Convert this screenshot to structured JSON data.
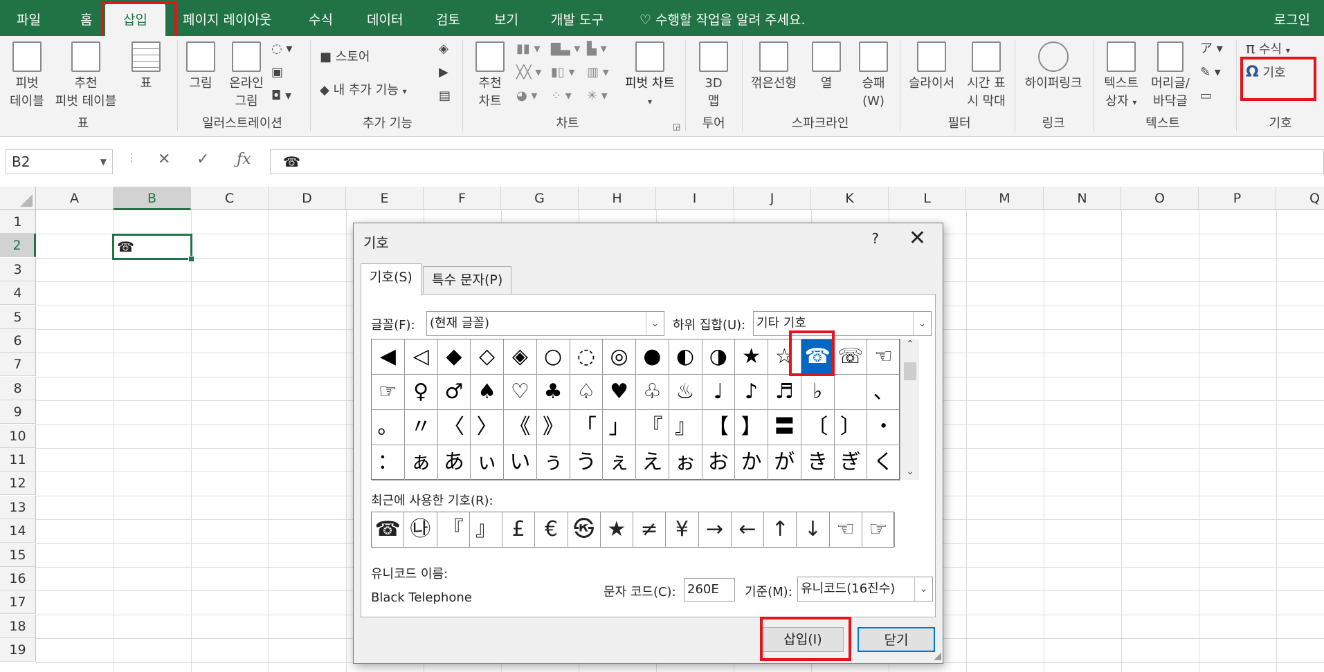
{
  "menu": {
    "tabs": [
      "파일",
      "홈",
      "삽입",
      "페이지 레이아웃",
      "수식",
      "데이터",
      "검토",
      "보기",
      "개발 도구"
    ],
    "active_tab": "삽입",
    "tell_me": "수행할 작업을 알려 주세요.",
    "login": "로그인"
  },
  "ribbon": {
    "table_group": {
      "label": "표",
      "pivot_table": [
        "피벗",
        "테이블"
      ],
      "recommended_pivot": [
        "추천",
        "피벗 테이블"
      ],
      "table": "표"
    },
    "illustrations_group": {
      "label": "일러스트레이션",
      "picture": "그림",
      "online_picture": [
        "온라인",
        "그림"
      ]
    },
    "addins_group": {
      "label": "추가 기능",
      "store": "스토어",
      "my_addins": "내 추가 기능"
    },
    "charts_group": {
      "label": "차트",
      "recommended_charts": [
        "추천",
        "차트"
      ],
      "pivot_chart": "피벗 차트"
    },
    "tours_group": {
      "label": "투어",
      "map_3d": [
        "3D",
        "맵"
      ]
    },
    "sparklines_group": {
      "label": "스파크라인",
      "line": "꺾은선형",
      "column": "열",
      "win_loss": [
        "승패",
        "(W)"
      ]
    },
    "filters_group": {
      "label": "필터",
      "slicer": "슬라이서",
      "timeline": [
        "시간 표",
        "시 막대"
      ]
    },
    "links_group": {
      "label": "링크",
      "hyperlink": "하이퍼링크"
    },
    "text_group": {
      "label": "텍스트",
      "text_box": [
        "텍스트",
        "상자"
      ],
      "header_footer": [
        "머리글/",
        "바닥글"
      ]
    },
    "symbols_group": {
      "label": "기호",
      "equation": "수식",
      "symbol": "기호"
    }
  },
  "formula_bar": {
    "name_box": "B2",
    "value": "☎"
  },
  "grid": {
    "columns": [
      "A",
      "B",
      "C",
      "D",
      "E",
      "F",
      "G",
      "H",
      "I",
      "J",
      "K",
      "L",
      "M",
      "N",
      "O",
      "P",
      "Q"
    ],
    "rows": [
      "1",
      "2",
      "3",
      "4",
      "5",
      "6",
      "7",
      "8",
      "9",
      "10",
      "11",
      "12",
      "13",
      "14",
      "15",
      "16",
      "17",
      "18",
      "19"
    ],
    "selected_column": "B",
    "selected_row": "2",
    "active_cell_value": "☎"
  },
  "dialog": {
    "title": "기호",
    "help": "?",
    "close": "✕",
    "tabs": [
      "기호(S)",
      "특수 문자(P)"
    ],
    "font_label": "글꼴(F):",
    "font_value": "(현재 글꼴)",
    "subset_label": "하위 집합(U):",
    "subset_value": "기타 기호",
    "symbol_rows": [
      [
        "◀",
        "◁",
        "◆",
        "◇",
        "◈",
        "○",
        "◌",
        "◎",
        "●",
        "◐",
        "◑",
        "★",
        "☆",
        "☎",
        "☏",
        "☜"
      ],
      [
        "☞",
        "♀",
        "♂",
        "♠",
        "♡",
        "♣",
        "♤",
        "♥",
        "♧",
        "♨",
        "♩",
        "♪",
        "♬",
        "♭",
        "",
        "、"
      ],
      [
        "。",
        "〃",
        "〈",
        "〉",
        "《",
        "》",
        "「",
        "」",
        "『",
        "』",
        "【",
        "】",
        "〓",
        "〔",
        "〕",
        "・"
      ],
      [
        "：",
        "ぁ",
        "あ",
        "ぃ",
        "い",
        "ぅ",
        "う",
        "ぇ",
        "え",
        "ぉ",
        "お",
        "か",
        "が",
        "き",
        "ぎ",
        "く"
      ]
    ],
    "selected_symbol": "☎",
    "recent_label": "최근에 사용한 기호(R):",
    "recent_symbols": [
      "☎",
      "㉯",
      "『",
      "』",
      "£",
      "€",
      "㉿",
      "★",
      "≠",
      "¥",
      "→",
      "←",
      "↑",
      "↓",
      "☜",
      "☞"
    ],
    "unicode_name_label": "유니코드 이름:",
    "unicode_name": "Black Telephone",
    "char_code_label": "문자 코드(C):",
    "char_code": "260E",
    "from_label": "기준(M):",
    "from_value": "유니코드(16진수)",
    "insert_button": "삽입(I)",
    "close_button": "닫기"
  },
  "colors": {
    "excel_green": "#217346",
    "highlight_red": "#e0161b",
    "selection_blue": "#0067c5"
  }
}
